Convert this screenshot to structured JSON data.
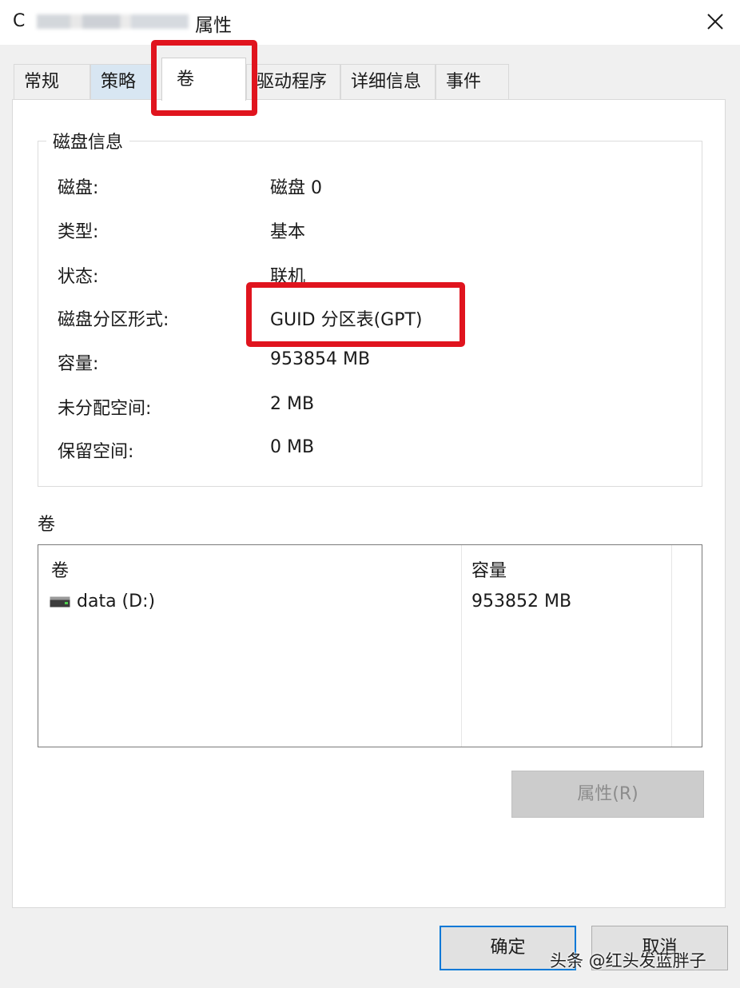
{
  "window": {
    "title_initial": "C",
    "title": "属性",
    "close_glyph": "close-icon"
  },
  "tabs": [
    {
      "label": "常规"
    },
    {
      "label": "策略"
    },
    {
      "label": "卷"
    },
    {
      "label": "驱动程序"
    },
    {
      "label": "详细信息"
    },
    {
      "label": "事件"
    }
  ],
  "disk_info": {
    "legend": "磁盘信息",
    "rows": [
      {
        "label": "磁盘:",
        "value": "磁盘 0"
      },
      {
        "label": "类型:",
        "value": "基本"
      },
      {
        "label": "状态:",
        "value": "联机"
      },
      {
        "label": "磁盘分区形式:",
        "value": "GUID 分区表(GPT)"
      },
      {
        "label": "容量:",
        "value": "953854 MB"
      },
      {
        "label": "未分配空间:",
        "value": "2 MB"
      },
      {
        "label": "保留空间:",
        "value": "0 MB"
      }
    ]
  },
  "volumes": {
    "section_label": "卷",
    "columns": [
      "卷",
      "容量"
    ],
    "rows": [
      {
        "name": "data (D:)",
        "capacity": "953852 MB",
        "icon": "drive-icon"
      }
    ]
  },
  "buttons": {
    "properties": "属性(R)",
    "ok": "确定",
    "cancel": "取消"
  },
  "watermark": "头条 @红头发蓝胖子",
  "colors": {
    "highlight": "#e0141e",
    "focus_border": "#0078d7",
    "hover_tab": "#d8e6f2"
  }
}
